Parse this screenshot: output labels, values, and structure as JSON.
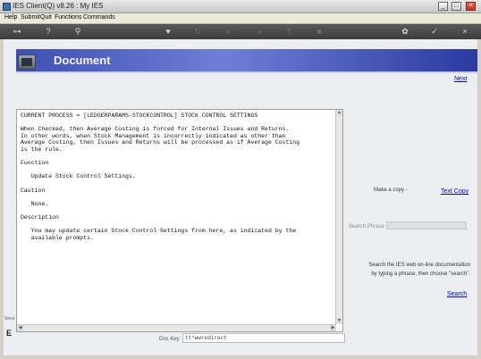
{
  "window": {
    "title": "IES Client(Q) v8.26 : My IES",
    "minimize": "_",
    "maximize": "□",
    "close": "×"
  },
  "menu": [
    "Help",
    "Submit",
    "Quit",
    "Functions",
    "Commands"
  ],
  "toolbar": {
    "icons": [
      "key-icon",
      "help-icon",
      "search-icon",
      "heart-icon",
      "refresh-icon",
      "back-icon",
      "forward-icon",
      "upload-icon",
      "stop-icon",
      "settings-icon",
      "check-icon",
      "close-icon"
    ]
  },
  "banner": {
    "title": "Document"
  },
  "links": {
    "next": "Next",
    "text_copy": "Text Copy",
    "search": "Search"
  },
  "document": {
    "text": "CURRENT PROCESS = [LEDGERPARAMS-STOCKCONTROL] STOCK CONTROL SETTINGS\n\nWhen Checked, then Average Costing is forced for Internal Issues and Returns.\nIn other words, when Stock Management is incorrectly indicated as other than\nAverage Costing, then Issues and Returns will be processed as if Average Costing\nis the rule.\n\nFunction\n\n   Update Stock Control Settings.\n\nCaution\n\n   None.\n\nDescription\n\n   You may update certain Stock Control Settings from here, as indicated by the\n   available prompts."
  },
  "right_panel": {
    "make_copy_label": "Make a copy -",
    "search_phrase_label": "Search Phrase",
    "search_phrase_value": "",
    "help_line1": "Search the IES web on-line documentation",
    "help_line2": "by typing a phrase, then choose \"search\"."
  },
  "doc_key": {
    "label": "Doc Key",
    "value": "tt*wwredirect"
  },
  "left_edge": {
    "label": "Seco",
    "mark": "E"
  }
}
